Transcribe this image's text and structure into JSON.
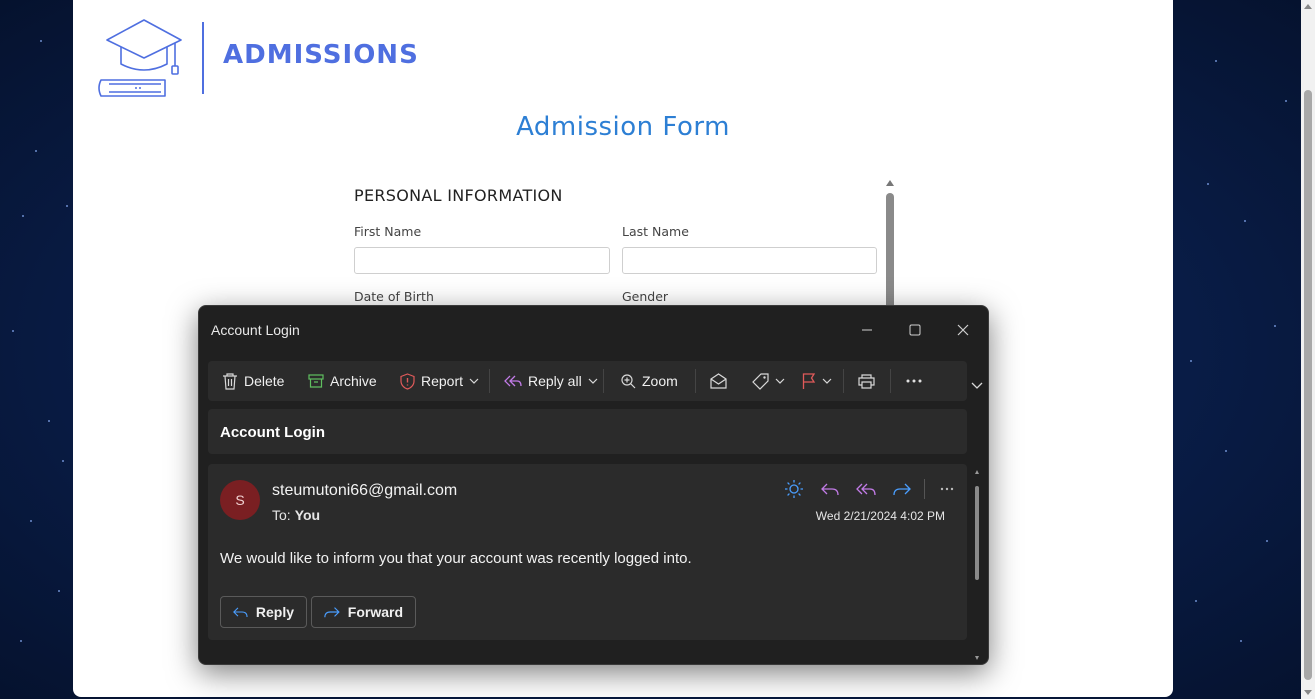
{
  "page": {
    "brand": "ADMISSIONS",
    "form_title": "Admission Form",
    "section_title": "PERSONAL INFORMATION",
    "fields": {
      "first_name_label": "First Name",
      "last_name_label": "Last Name",
      "dob_label": "Date of Birth",
      "gender_label": "Gender",
      "first_name_value": "",
      "last_name_value": ""
    }
  },
  "mail_window": {
    "title": "Account Login",
    "controls": [
      "minimize-icon",
      "maximize-icon",
      "close-icon"
    ],
    "toolbar": {
      "delete": "Delete",
      "archive": "Archive",
      "report": "Report",
      "reply_all": "Reply all",
      "zoom": "Zoom",
      "icons": [
        "mark-read-icon",
        "tag-icon",
        "flag-icon",
        "print-icon",
        "more-icon"
      ]
    },
    "subject": "Account Login",
    "message": {
      "avatar_initial": "S",
      "sender": "steumutoni66@gmail.com",
      "to_label": "To:",
      "to_value": "You",
      "date": "Wed 2/21/2024 4:02 PM",
      "body": "We would like to inform you that your account was recently logged into.",
      "reply_button": "Reply",
      "forward_button": "Forward",
      "action_icons": [
        "sun-icon",
        "reply-icon",
        "reply-all-icon",
        "forward-icon",
        "more-icon"
      ]
    }
  },
  "colors": {
    "brand_blue": "#4f6fe0",
    "form_title_blue": "#2d7fd4",
    "window_bg": "#202020",
    "panel_bg": "#2b2b2b",
    "avatar_bg": "#7a1f22",
    "archive_green": "#5fbf5f",
    "report_red": "#e05a5a",
    "reply_all_purple": "#c17be6",
    "flag_red": "#e05a5a",
    "sun_blue": "#4a9eff"
  }
}
